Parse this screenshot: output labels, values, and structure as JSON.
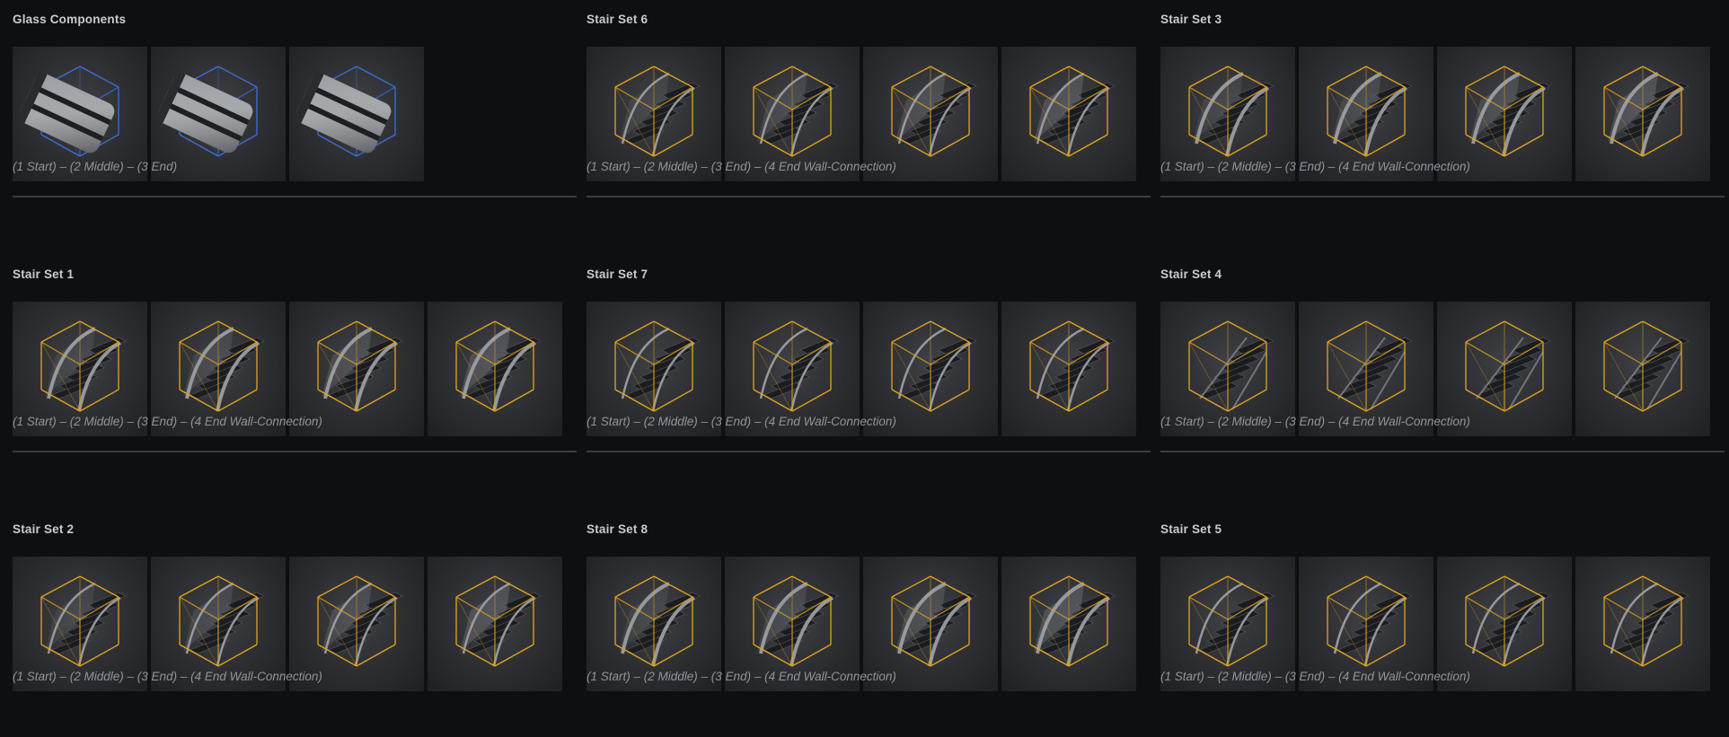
{
  "accent_colors": {
    "glass_bbox": "#3b6fd8",
    "stair_bbox": "#e2a41d",
    "title": "#c8ccd0",
    "caption": "#8f959b",
    "rule": "#3a3d42",
    "background": "#0e0f10"
  },
  "columns": [
    {
      "sections": [
        {
          "title": "Glass Components",
          "caption": "(1 Start) – (2 Middle) – (3 End)",
          "kind": "glass",
          "thumb_count": 3
        },
        {
          "title": "Stair Set 1",
          "caption": "(1 Start) – (2 Middle) – (3 End) – (4 End Wall-Connection)",
          "kind": "stair",
          "thumb_count": 4
        },
        {
          "title": "Stair Set 2",
          "caption": "(1 Start) – (2 Middle) – (3 End) – (4 End Wall-Connection)",
          "kind": "stair",
          "thumb_count": 4
        }
      ]
    },
    {
      "sections": [
        {
          "title": "Stair Set 6",
          "caption": "(1 Start) – (2 Middle) – (3 End) – (4 End Wall-Connection)",
          "kind": "stair",
          "thumb_count": 4
        },
        {
          "title": "Stair Set 7",
          "caption": "(1 Start) – (2 Middle) – (3 End) – (4 End Wall-Connection)",
          "kind": "stair",
          "thumb_count": 4
        },
        {
          "title": "Stair Set 8",
          "caption": "(1 Start) – (2 Middle) – (3 End) – (4 End Wall-Connection)",
          "kind": "stair",
          "thumb_count": 4
        }
      ]
    },
    {
      "sections": [
        {
          "title": "Stair Set 3",
          "caption": "(1 Start) – (2 Middle) – (3 End) – (4 End Wall-Connection)",
          "kind": "stair",
          "thumb_count": 4
        },
        {
          "title": "Stair Set 4",
          "caption": "(1 Start) – (2 Middle) – (3 End) – (4 End Wall-Connection)",
          "kind": "stair",
          "thumb_count": 4
        },
        {
          "title": "Stair Set 5",
          "caption": "(1 Start) – (2 Middle) – (3 End) – (4 End Wall-Connection)",
          "kind": "stair",
          "thumb_count": 4
        }
      ]
    }
  ]
}
